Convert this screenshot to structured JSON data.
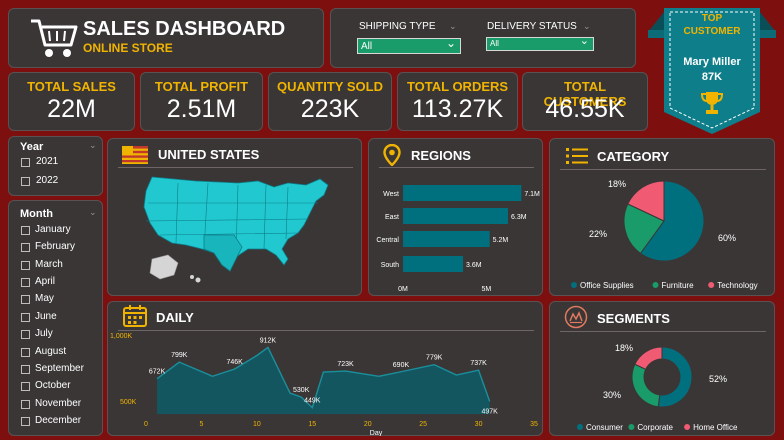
{
  "header": {
    "title": "SALES DASHBOARD",
    "subtitle": "ONLINE STORE"
  },
  "filters": {
    "shipping_type": {
      "label": "SHIPPING TYPE",
      "value": "All"
    },
    "delivery_status": {
      "label": "DELIVERY STATUS",
      "value": "All"
    }
  },
  "top_customer": {
    "heading_line1": "TOP",
    "heading_line2": "CUSTOMER",
    "name": "Mary Miller",
    "value": "87K"
  },
  "kpis": [
    {
      "label": "TOTAL SALES",
      "value": "22M"
    },
    {
      "label": "TOTAL PROFIT",
      "value": "2.51M"
    },
    {
      "label": "QUANTITY SOLD",
      "value": "223K"
    },
    {
      "label": "TOTAL ORDERS",
      "value": "113.27K"
    },
    {
      "label": "TOTAL CUSTOMERS",
      "value": "46.55K"
    }
  ],
  "year_slicer": {
    "title": "Year",
    "options": [
      "2021",
      "2022"
    ]
  },
  "month_slicer": {
    "title": "Month",
    "options": [
      "January",
      "February",
      "March",
      "April",
      "May",
      "June",
      "July",
      "August",
      "September",
      "October",
      "November",
      "December"
    ]
  },
  "map_panel": {
    "title": "UNITED STATES"
  },
  "regions_panel": {
    "title": "REGIONS"
  },
  "category_panel": {
    "title": "CATEGORY"
  },
  "daily_panel": {
    "title": "DAILY"
  },
  "segments_panel": {
    "title": "SEGMENTS"
  },
  "colors": {
    "background": "#7d0f0f",
    "panel": "#3a3636",
    "accent_gold": "#f0b400",
    "teal": "#00707f",
    "green": "#1a9b6a",
    "pink": "#f05a72",
    "map_cyan": "#21c8cf"
  },
  "icons": {
    "header": "shopping-cart-icon",
    "top_customer": "trophy-icon",
    "map": "us-flag-icon",
    "regions": "location-pin-icon",
    "category": "list-icon",
    "daily": "calendar-icon",
    "segments": "segments-logo-icon"
  },
  "chart_data": [
    {
      "type": "bar",
      "orientation": "horizontal",
      "categories": [
        "West",
        "East",
        "Central",
        "South"
      ],
      "values": [
        7.1,
        6.3,
        5.2,
        3.6
      ],
      "value_labels": [
        "7.1M",
        "6.3M",
        "5.2M",
        "3.6M"
      ],
      "xticks": [
        "0M",
        "5M"
      ],
      "xlim": [
        0,
        7.5
      ],
      "color": "#00707f"
    },
    {
      "type": "pie",
      "labels": [
        "Office Supplies",
        "Furniture",
        "Technology"
      ],
      "values": [
        60,
        22,
        18
      ],
      "value_labels": [
        "60%",
        "22%",
        "18%"
      ],
      "colors": [
        "#00707f",
        "#1a9b6a",
        "#f05a72"
      ],
      "legend": "bottom"
    },
    {
      "type": "area",
      "xlabel": "Day",
      "x": [
        1,
        3,
        6,
        8,
        10,
        11,
        13,
        14,
        15,
        16,
        18,
        21,
        23,
        26,
        28,
        30,
        31
      ],
      "y": [
        672,
        799,
        690,
        746,
        850,
        912,
        560,
        530,
        449,
        723,
        730,
        690,
        725,
        779,
        700,
        737,
        497
      ],
      "data_labels": [
        {
          "day": 1,
          "text": "672K"
        },
        {
          "day": 3,
          "text": "799K"
        },
        {
          "day": 8,
          "text": "746K"
        },
        {
          "day": 11,
          "text": "912K"
        },
        {
          "day": 14,
          "text": "530K"
        },
        {
          "day": 15,
          "text": "449K"
        },
        {
          "day": 18,
          "text": "723K"
        },
        {
          "day": 23,
          "text": "690K"
        },
        {
          "day": 26,
          "text": "779K"
        },
        {
          "day": 30,
          "text": "737K"
        },
        {
          "day": 31,
          "text": "497K"
        }
      ],
      "xticks": [
        0,
        5,
        10,
        15,
        20,
        25,
        30,
        35
      ],
      "yticks": [
        "500K",
        "1,000K"
      ],
      "xlim": [
        0,
        35
      ],
      "ylim": [
        400,
        1000
      ],
      "color": "#00707f"
    },
    {
      "type": "pie",
      "donut": true,
      "labels": [
        "Consumer",
        "Corporate",
        "Home Office"
      ],
      "values": [
        52,
        30,
        18
      ],
      "value_labels": [
        "52%",
        "30%",
        "18%"
      ],
      "colors": [
        "#00707f",
        "#1a9b6a",
        "#f05a72"
      ],
      "legend": "bottom"
    }
  ]
}
